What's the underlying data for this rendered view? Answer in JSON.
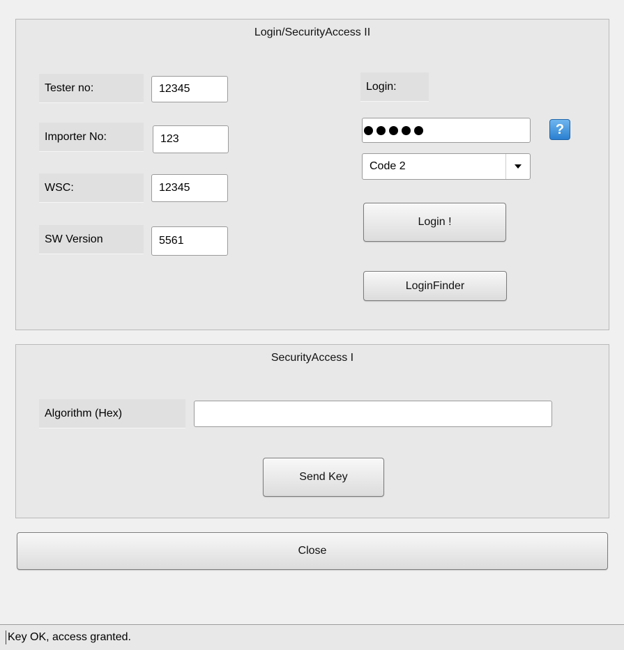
{
  "login_panel": {
    "title": "Login/SecurityAccess II",
    "tester_label": "Tester no:",
    "tester_value": "12345",
    "importer_label": "Importer No:",
    "importer_value": "123",
    "wsc_label": "WSC:",
    "wsc_value": "12345",
    "sw_label": "SW Version",
    "sw_value": "5561",
    "login_label": "Login:",
    "password_length": 5,
    "help_icon_text": "?",
    "code_selected": "Code 2",
    "login_button": "Login !",
    "finder_button": "LoginFinder"
  },
  "security_panel": {
    "title": "SecurityAccess I",
    "algorithm_label": "Algorithm (Hex)",
    "algorithm_value": "",
    "send_button": "Send Key"
  },
  "close_button": "Close",
  "status_text": "Key OK, access granted.",
  "icons": {
    "help": "help-question-icon",
    "dropdown": "chevron-down-icon"
  },
  "colors": {
    "help_icon": "#2a7fd0",
    "panel_bg": "#e8e8e8"
  }
}
